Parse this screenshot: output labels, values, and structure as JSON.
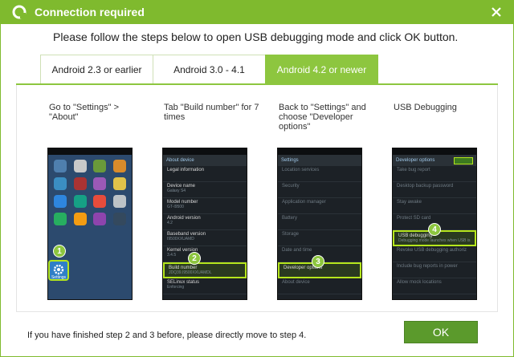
{
  "titlebar": {
    "title": "Connection required",
    "logo_icon": "app-logo-icon",
    "close_icon": "close-icon",
    "accent_color": "#7fba2e"
  },
  "instruction": "Please follow the steps below to open USB debugging mode and click OK button.",
  "tabs": [
    {
      "label": "Android 2.3 or earlier",
      "active": false
    },
    {
      "label": "Android 3.0 - 4.1",
      "active": false
    },
    {
      "label": "Android 4.2 or newer",
      "active": true
    }
  ],
  "steps": [
    {
      "text": "Go to \"Settings\" > \"About\"",
      "badge": "1"
    },
    {
      "text": "Tab \"Build number\" for 7 times",
      "badge": "2"
    },
    {
      "text": "Back to \"Settings\" and choose \"Developer options\"",
      "badge": "3"
    },
    {
      "text": "USB Debugging",
      "badge": "4"
    }
  ],
  "phone2": {
    "header": "About device",
    "rows": [
      {
        "title": "Legal information",
        "sub": ""
      },
      {
        "title": "Device name",
        "sub": "Galaxy S4"
      },
      {
        "title": "Model number",
        "sub": "GT-I9500"
      },
      {
        "title": "Android version",
        "sub": "4.2"
      },
      {
        "title": "Baseband version",
        "sub": "I9500XXUAMD"
      },
      {
        "title": "Kernel version",
        "sub": "3.4.5"
      },
      {
        "title": "Build number",
        "sub": "JDQ39.I9500XXUAMDL"
      },
      {
        "title": "SELinux status",
        "sub": "Enforcing"
      }
    ]
  },
  "phone3": {
    "header": "Settings",
    "rows": [
      {
        "title": "Location services",
        "sub": ""
      },
      {
        "title": "Security",
        "sub": ""
      },
      {
        "title": "Application manager",
        "sub": ""
      },
      {
        "title": "Battery",
        "sub": ""
      },
      {
        "title": "Storage",
        "sub": ""
      },
      {
        "title": "Date and time",
        "sub": ""
      },
      {
        "title": "Developer options",
        "sub": ""
      },
      {
        "title": "About device",
        "sub": ""
      }
    ]
  },
  "phone4": {
    "header": "Developer options",
    "rows": [
      {
        "title": "Take bug report",
        "sub": ""
      },
      {
        "title": "Desktop backup password",
        "sub": ""
      },
      {
        "title": "Stay awake",
        "sub": ""
      },
      {
        "title": "Protect SD card",
        "sub": ""
      },
      {
        "title": "USB debugging",
        "sub": "Debugging mode launches when USB is"
      },
      {
        "title": "Revoke USB debugging authoriz",
        "sub": ""
      },
      {
        "title": "Include bug reports in power",
        "sub": ""
      },
      {
        "title": "Allow mock locations",
        "sub": ""
      }
    ]
  },
  "phone1": {
    "settings_label": "Settings"
  },
  "footer": {
    "note": "If you have finished step 2 and 3 before, please directly move to step 4.",
    "ok_label": "OK"
  }
}
